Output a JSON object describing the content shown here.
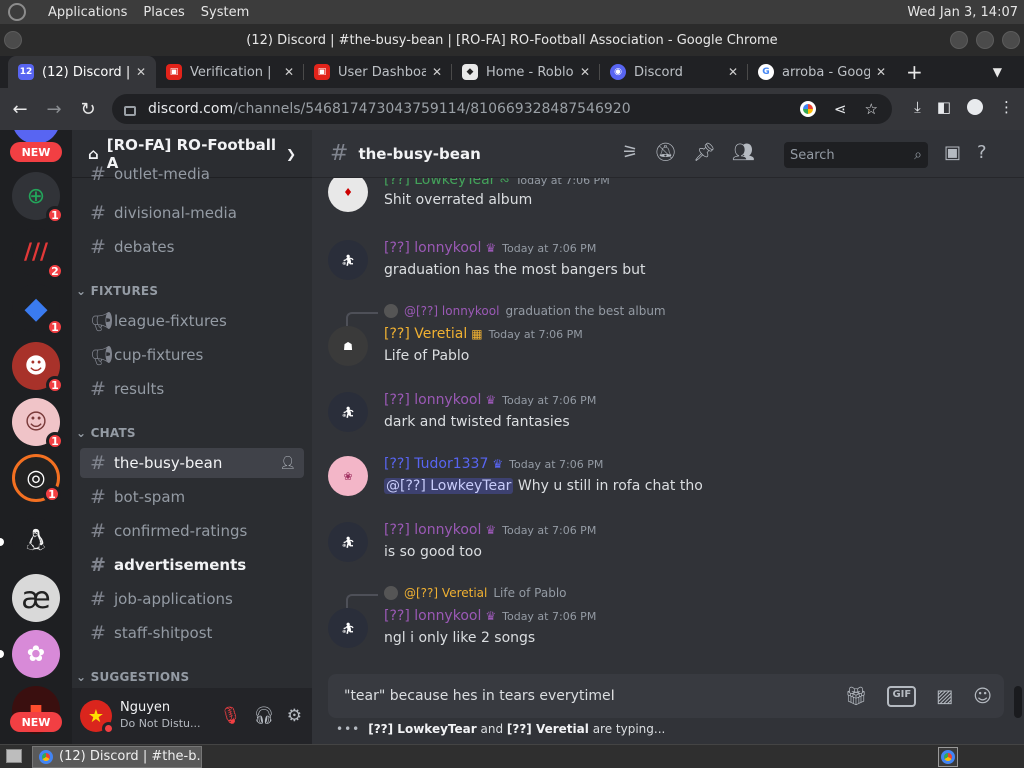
{
  "os": {
    "menus": [
      "Applications",
      "Places",
      "System"
    ],
    "clock": "Wed Jan  3, 14:07"
  },
  "window": {
    "title": "(12) Discord | #the-busy-bean | [RO-FA] RO-Football Association - Google Chrome"
  },
  "tabs": [
    {
      "label": "(12) Discord | #",
      "active": true
    },
    {
      "label": "Verification | ",
      "active": false
    },
    {
      "label": "User Dashboa",
      "active": false
    },
    {
      "label": "Home - Roblo",
      "active": false
    },
    {
      "label": "Discord",
      "active": false
    },
    {
      "label": "arroba - Goog",
      "active": false
    }
  ],
  "address": {
    "domain": "discord.com",
    "path": "/channels/546817473043759114/810669328487546920"
  },
  "guilds": [
    {
      "badge": "NEW"
    },
    {
      "badge": "1"
    },
    {
      "badge": "2"
    },
    {
      "badge": "1"
    },
    {
      "badge": "1"
    },
    {
      "badge": "1"
    },
    {
      "badge": "1"
    },
    {
      "glyph": "æ"
    },
    {
      "badge": "NEW"
    }
  ],
  "server": {
    "name": "[RO-FA] RO-Football A",
    "channels_top": [
      {
        "name": "outlet-media"
      },
      {
        "name": "divisional-media"
      },
      {
        "name": "debates"
      }
    ],
    "categories": [
      "FIXTURES",
      "CHATS",
      "SUGGESTIONS"
    ],
    "fixtures": [
      {
        "name": "league-fixtures"
      },
      {
        "name": "cup-fixtures"
      },
      {
        "name": "results"
      }
    ],
    "chats": [
      {
        "name": "the-busy-bean"
      },
      {
        "name": "bot-spam"
      },
      {
        "name": "confirmed-ratings"
      },
      {
        "name": "advertisements"
      },
      {
        "name": "job-applications"
      },
      {
        "name": "staff-shitpost"
      }
    ]
  },
  "user": {
    "name": "Nguyen",
    "status": "Do Not Distu..."
  },
  "channel": {
    "name": "the-busy-bean",
    "search_placeholder": "Search"
  },
  "messages": [
    {
      "author": "[??] LowkeyTear",
      "time": "Today at 7:06 PM",
      "text": "Shit overrated album"
    },
    {
      "author": "[??] lonnykool",
      "time": "Today at 7:06 PM",
      "text": "graduation has the most bangers but"
    },
    {
      "reply_author": "@[??] lonnykool",
      "reply_text": "graduation the best album",
      "author": "[??] Veretial",
      "time": "Today at 7:06 PM",
      "text": "Life of Pablo"
    },
    {
      "author": "[??] lonnykool",
      "time": "Today at 7:06 PM",
      "text": "dark and twisted fantasies"
    },
    {
      "author": "[??] Tudor1337",
      "time": "Today at 7:06 PM",
      "mention": "@[??] LowkeyTear",
      "text": " Why u still in rofa chat tho"
    },
    {
      "author": "[??] lonnykool",
      "time": "Today at 7:06 PM",
      "text": "is so good too"
    },
    {
      "reply_author": "@[??] Veretial",
      "reply_text": "Life of Pablo",
      "author": "[??] lonnykool",
      "time": "Today at 7:06 PM",
      "text": "ngl i only like 2 songs"
    }
  ],
  "composer": {
    "value": "\"tear\" because hes in tears everytime"
  },
  "typing": {
    "user1": "[??] LowkeyTear",
    "joiner": "and",
    "user2": "[??] Veretial",
    "suffix": "are typing..."
  },
  "taskbar": {
    "task": "(12) Discord | #the-b..."
  },
  "colors": {
    "green_role": "#43a25a",
    "purple_role": "#9b59b6",
    "gold_role": "#f0b132",
    "blue_role": "#5865f2",
    "badge_red": "#f23f43"
  }
}
